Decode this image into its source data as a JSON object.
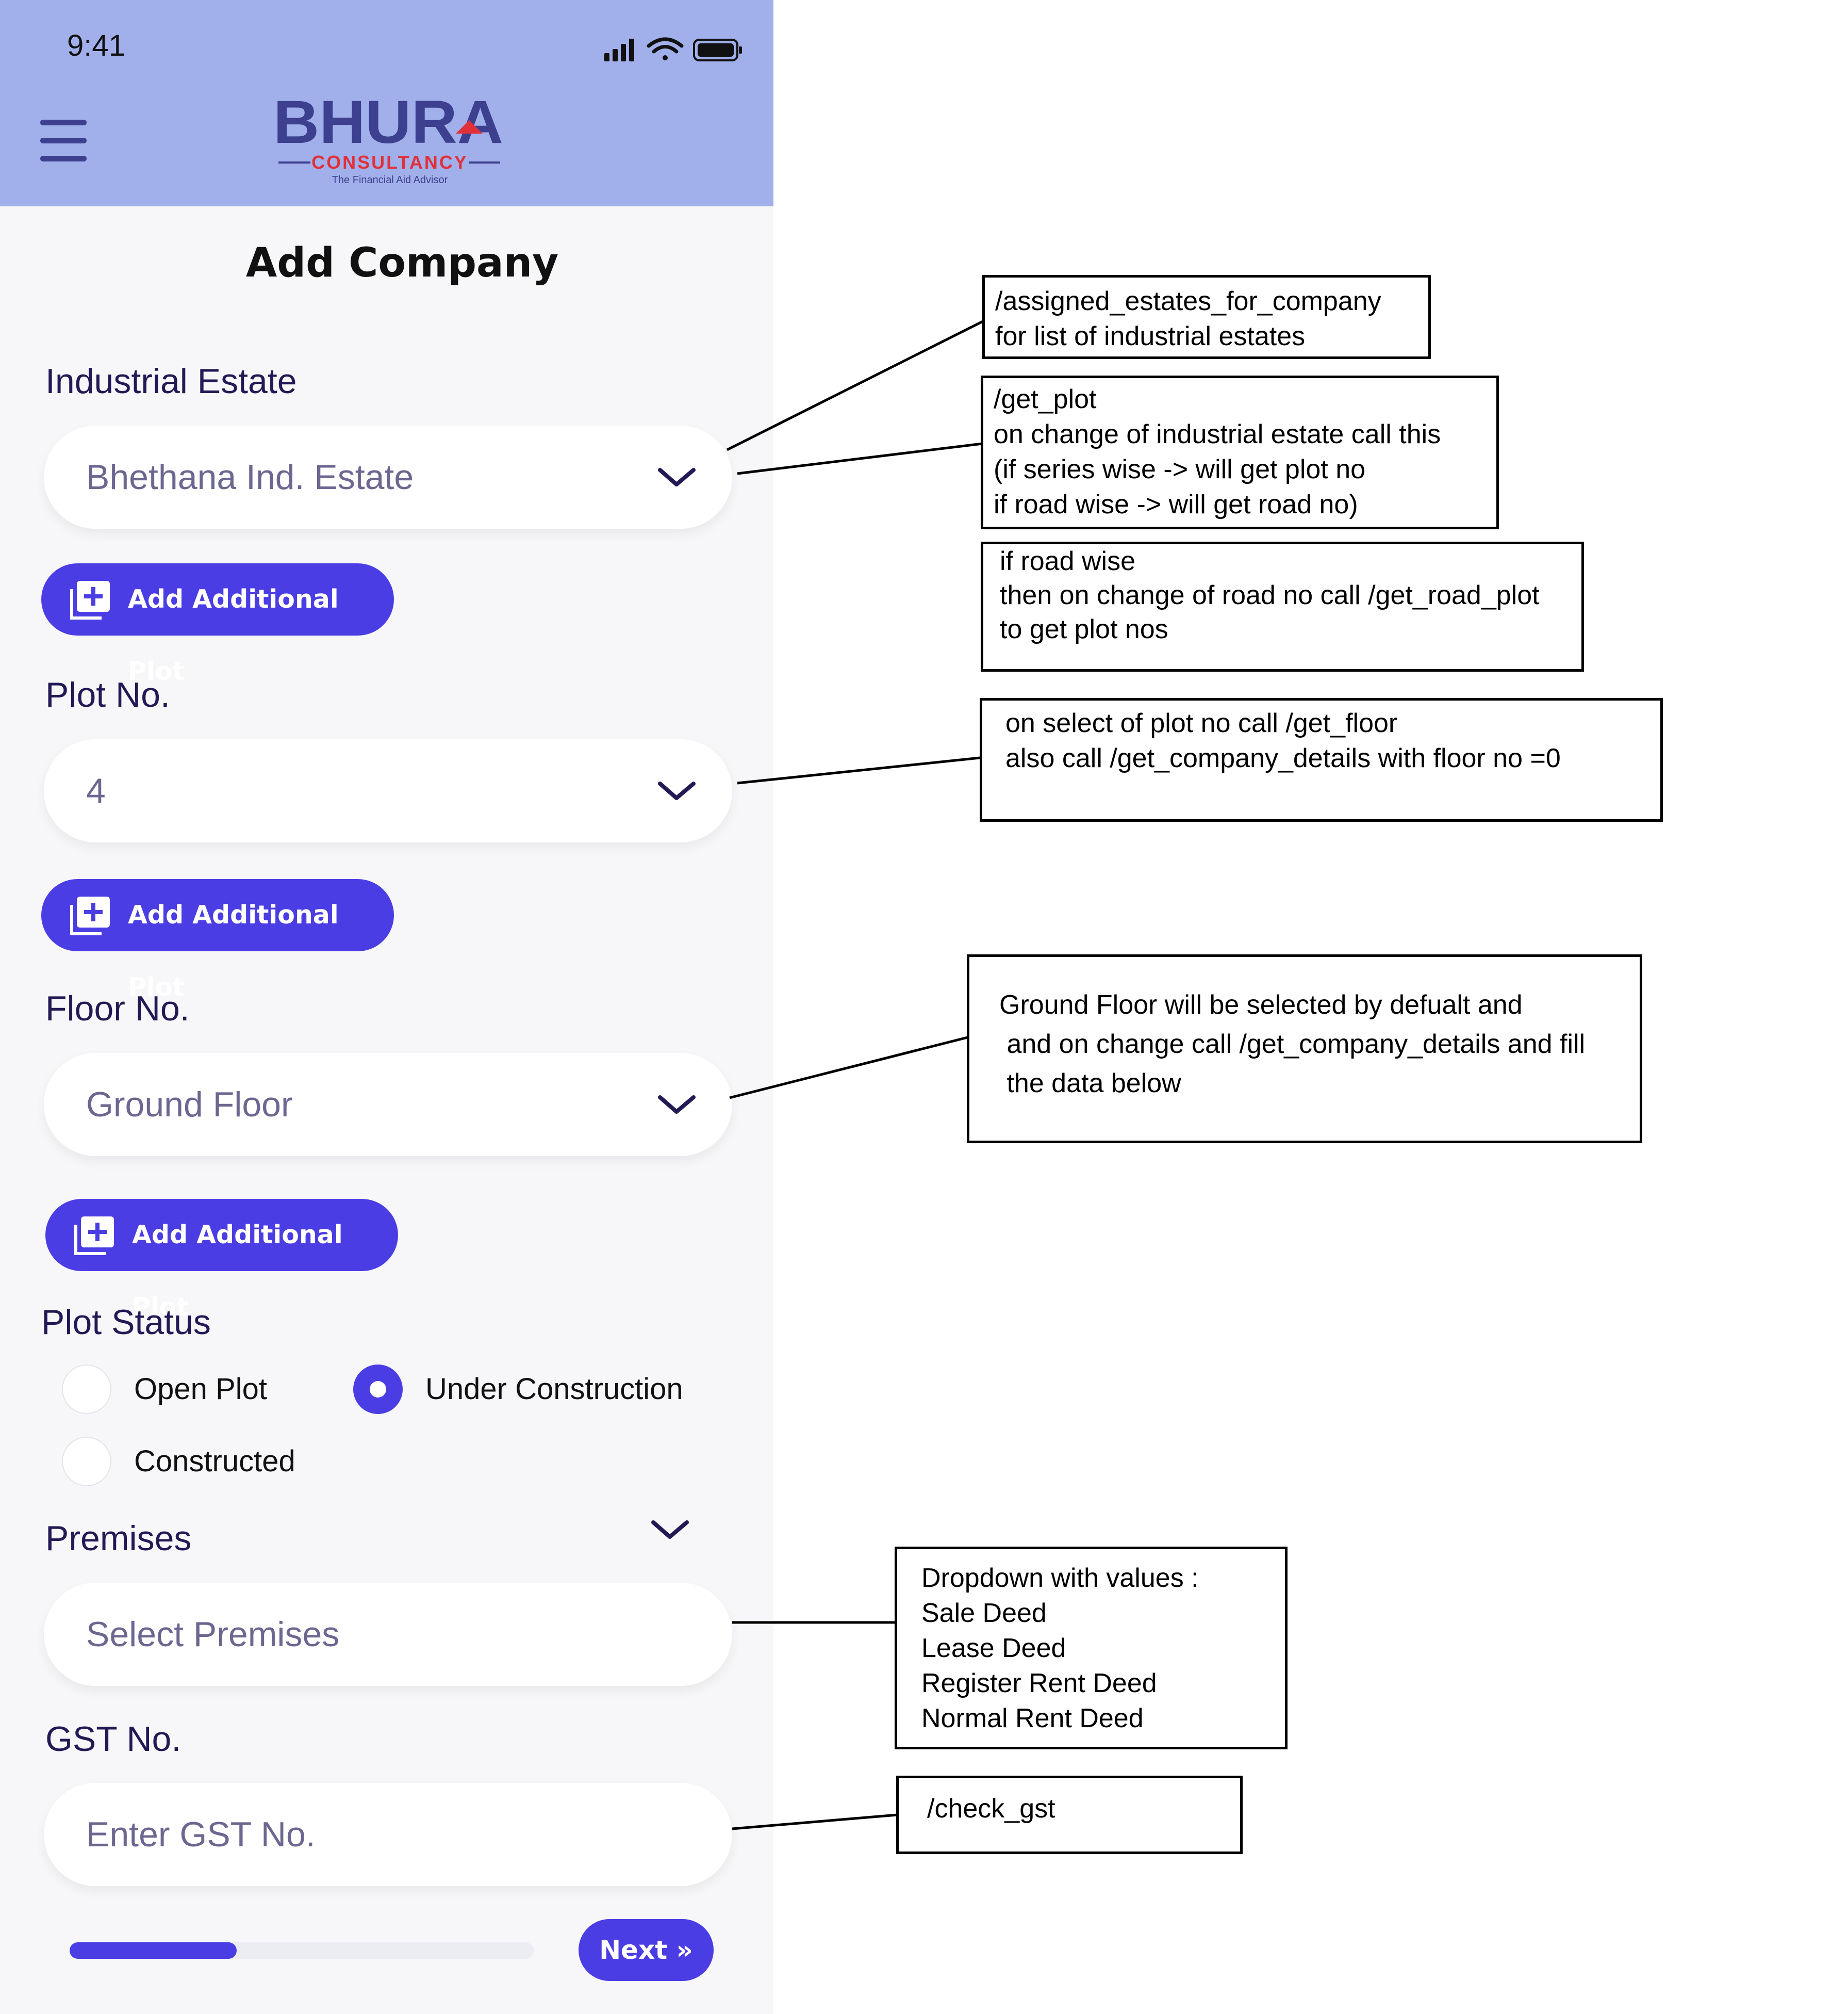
{
  "status_bar": {
    "time": "9:41"
  },
  "header": {
    "logo": {
      "main": "BHURA",
      "sub": "CONSULTANCY",
      "tagline": "The Financial Aid Advisor"
    },
    "accent": "#a1b0ea"
  },
  "page_title": "Add Company",
  "form": {
    "industrial_estate": {
      "label": "Industrial Estate",
      "value": "Bhethana Ind. Estate"
    },
    "add_plot_label": "Add Additional Plot",
    "plot_no": {
      "label": "Plot No.",
      "value": "4"
    },
    "floor_no": {
      "label": "Floor No.",
      "value": "Ground Floor"
    },
    "plot_status": {
      "label": "Plot Status",
      "options": [
        "Open Plot",
        "Under Construction",
        "Constructed"
      ],
      "selected": "Under Construction"
    },
    "premises": {
      "label": "Premises",
      "placeholder": "Select Premises"
    },
    "gst": {
      "label": "GST No.",
      "placeholder": "Enter GST No."
    },
    "next_label": "Next »",
    "progress": 0.36
  },
  "annotations": [
    "/assigned_estates_for_company\nfor list of industrial estates",
    "/get_plot\non change of industrial estate call this\n(if series wise -> will get plot no\nif road wise -> will get road no)",
    "if road wise\nthen on change of road no call /get_road_plot\nto get plot nos",
    "on select of plot no call /get_floor\nalso call /get_company_details with floor no =0",
    "Ground Floor will be selected by defualt and\n and on change call /get_company_details and fill\n the data below",
    "Dropdown with values :\nSale Deed\nLease Deed\nRegister Rent Deed\nNormal Rent Deed",
    "/check_gst"
  ],
  "colors": {
    "primary": "#4b3de4",
    "label": "#221a55",
    "placeholder": "#6b6790",
    "logo_blue": "#3d3f8f",
    "logo_red": "#e0313b"
  }
}
